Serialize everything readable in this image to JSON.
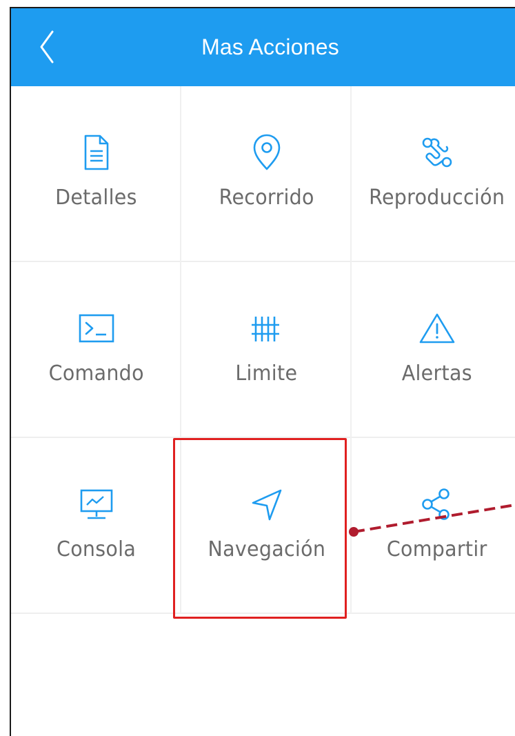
{
  "header": {
    "title": "Mas Acciones"
  },
  "actions": [
    {
      "label": "Detalles",
      "icon": "document-icon"
    },
    {
      "label": "Recorrido",
      "icon": "location-pin-icon"
    },
    {
      "label": "Reproducción",
      "icon": "route-playback-icon"
    },
    {
      "label": "Comando",
      "icon": "terminal-icon"
    },
    {
      "label": "Limite",
      "icon": "fence-icon"
    },
    {
      "label": "Alertas",
      "icon": "warning-triangle-icon"
    },
    {
      "label": "Consola",
      "icon": "monitor-chart-icon"
    },
    {
      "label": "Navegación",
      "icon": "navigation-arrow-icon"
    },
    {
      "label": "Compartir",
      "icon": "share-icon"
    }
  ],
  "colors": {
    "header_bg": "#1e9cf0",
    "icon": "#1e9cf0",
    "label": "#6b6b6b",
    "highlight": "#e02020",
    "annotation": "#b01c2e"
  },
  "annotation": {
    "highlighted_action": "Navegación"
  }
}
